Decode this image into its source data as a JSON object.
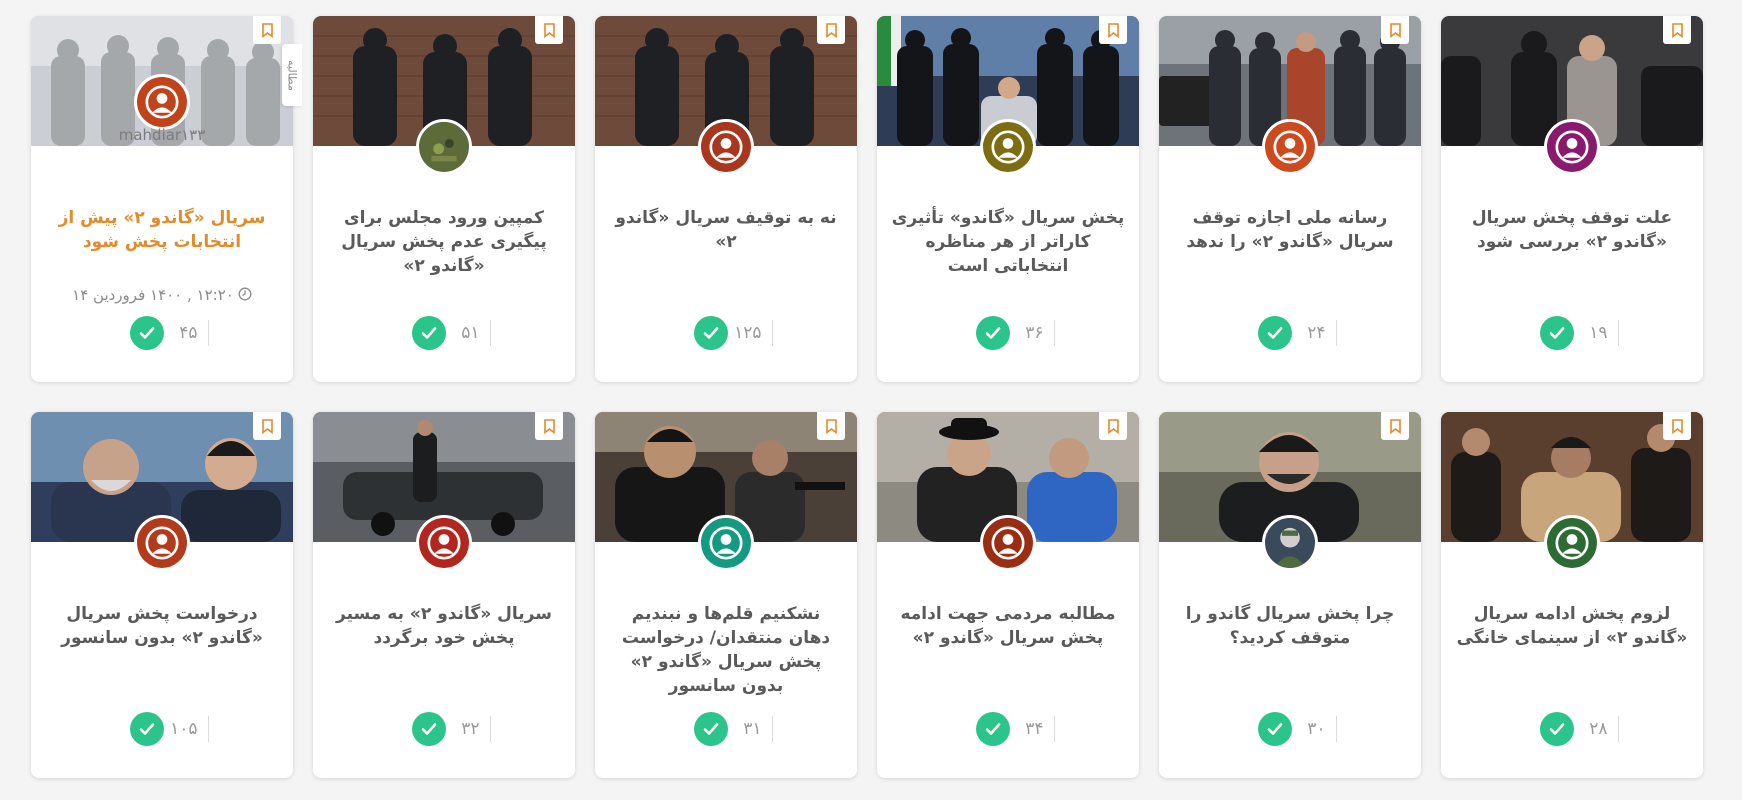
{
  "row1": [
    {
      "title": "سریال «گاندو ۲» پیش از انتخابات پخش شود",
      "count": "۴۵",
      "avatar": "#c0431b",
      "scene": "#5b6470",
      "hovered": true,
      "user": "mahdiar۱۳۳",
      "date": "۱۲:۲۰ , ۱۴۰۰ فروردین ۱۴",
      "tab": "مطالبه"
    },
    {
      "title": "کمپین ورود مجلس برای پیگیری عدم پخش سریال «گاندو ۲»",
      "count": "۵۱",
      "avatar": "#5d6a3a",
      "scene": "#6b4a3c"
    },
    {
      "title": "نه به توقیف سریال «گاندو ۲»",
      "count": "۱۲۵",
      "avatar": "#a8371d",
      "scene": "#6b4a3c"
    },
    {
      "title": "پخش سریال «گاندو» تأثیری کاراتر از هر مناظره انتخاباتی است",
      "count": "۳۶",
      "avatar": "#7c6d12",
      "scene": "#3a4b66"
    },
    {
      "title": "رسانه ملی اجازه توقف سریال «گاندو ۲» را ندهد",
      "count": "۲۴",
      "avatar": "#cc4a1e",
      "scene": "#6e737a"
    },
    {
      "title": "علت توقف پخش سریال «گاندو ۲» بررسی شود",
      "count": "۱۹",
      "avatar": "#8a1a6e",
      "scene": "#3e3e40"
    }
  ],
  "row2": [
    {
      "title": "درخواست پخش سریال «گاندو ۲» بدون سانسور",
      "count": "۱۰۵",
      "avatar": "#b43a1c",
      "scene": "#2e3e5c"
    },
    {
      "title": "سریال «گاندو ۲» به مسیر پخش خود برگردد",
      "count": "۳۲",
      "avatar": "#b3261e",
      "scene": "#4f5458"
    },
    {
      "title": "نشکنیم قلم‌ها و نبندیم دهان منتقدان/ درخواست پخش سریال «گاندو ۲» بدون سانسور",
      "count": "۳۱",
      "avatar": "#159a82",
      "scene": "#4a4038"
    },
    {
      "title": "مطالبه مردمی جهت ادامه پخش سریال «گاندو ۲»",
      "count": "۳۴",
      "avatar": "#9a2d12",
      "scene": "#3d5a8a"
    },
    {
      "title": "چرا پخش سریال گاندو را متوقف کردید؟",
      "count": "۳۰",
      "avatar": "#3a4a5a",
      "scene": "#3b3a34"
    },
    {
      "title": "لزوم پخش ادامه سریال «گاندو ۲» از سینمای خانگی",
      "count": "۲۸",
      "avatar": "#2d6b35",
      "scene": "#5a3e2e"
    }
  ]
}
